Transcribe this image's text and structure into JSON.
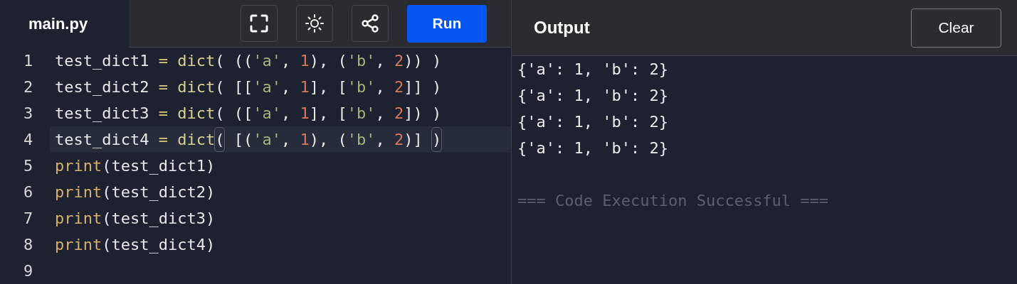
{
  "editor_tab": {
    "label": "main.py",
    "selected": true
  },
  "toolbar": {
    "run_label": "Run"
  },
  "output": {
    "title": "Output",
    "clear_label": "Clear",
    "lines": [
      {
        "kind": "result",
        "text": "{'a': 1, 'b': 2}"
      },
      {
        "kind": "result",
        "text": "{'a': 1, 'b': 2}"
      },
      {
        "kind": "result",
        "text": "{'a': 1, 'b': 2}"
      },
      {
        "kind": "result",
        "text": "{'a': 1, 'b': 2}"
      },
      {
        "kind": "status",
        "text": "=== Code Execution Successful ==="
      }
    ]
  },
  "code_lines": [
    {
      "number": "1",
      "active": false,
      "tokens": [
        {
          "kind": "plain",
          "text": "test_dict1"
        },
        {
          "kind": "op",
          "text": " = "
        },
        {
          "kind": "func",
          "text": "dict"
        },
        {
          "kind": "plain",
          "text": "( (("
        },
        {
          "kind": "str",
          "text": "'a'"
        },
        {
          "kind": "plain",
          "text": ", "
        },
        {
          "kind": "num",
          "text": "1"
        },
        {
          "kind": "plain",
          "text": "), ("
        },
        {
          "kind": "str",
          "text": "'b'"
        },
        {
          "kind": "plain",
          "text": ", "
        },
        {
          "kind": "num",
          "text": "2"
        },
        {
          "kind": "plain",
          "text": ")) )"
        }
      ]
    },
    {
      "number": "2",
      "active": false,
      "tokens": [
        {
          "kind": "plain",
          "text": "test_dict2"
        },
        {
          "kind": "op",
          "text": " = "
        },
        {
          "kind": "func",
          "text": "dict"
        },
        {
          "kind": "plain",
          "text": "( [["
        },
        {
          "kind": "str",
          "text": "'a'"
        },
        {
          "kind": "plain",
          "text": ", "
        },
        {
          "kind": "num",
          "text": "1"
        },
        {
          "kind": "plain",
          "text": "], ["
        },
        {
          "kind": "str",
          "text": "'b'"
        },
        {
          "kind": "plain",
          "text": ", "
        },
        {
          "kind": "num",
          "text": "2"
        },
        {
          "kind": "plain",
          "text": "]] )"
        }
      ]
    },
    {
      "number": "3",
      "active": false,
      "tokens": [
        {
          "kind": "plain",
          "text": "test_dict3"
        },
        {
          "kind": "op",
          "text": " = "
        },
        {
          "kind": "func",
          "text": "dict"
        },
        {
          "kind": "plain",
          "text": "( (["
        },
        {
          "kind": "str",
          "text": "'a'"
        },
        {
          "kind": "plain",
          "text": ", "
        },
        {
          "kind": "num",
          "text": "1"
        },
        {
          "kind": "plain",
          "text": "], ["
        },
        {
          "kind": "str",
          "text": "'b'"
        },
        {
          "kind": "plain",
          "text": ", "
        },
        {
          "kind": "num",
          "text": "2"
        },
        {
          "kind": "plain",
          "text": "]) )"
        }
      ]
    },
    {
      "number": "4",
      "active": true,
      "tokens": [
        {
          "kind": "plain",
          "text": "test_dict4"
        },
        {
          "kind": "op",
          "text": " = "
        },
        {
          "kind": "func",
          "text": "dict"
        },
        {
          "kind": "bracket_match",
          "text": "("
        },
        {
          "kind": "plain",
          "text": " [("
        },
        {
          "kind": "str",
          "text": "'a'"
        },
        {
          "kind": "plain",
          "text": ", "
        },
        {
          "kind": "num",
          "text": "1"
        },
        {
          "kind": "plain",
          "text": "), ("
        },
        {
          "kind": "str",
          "text": "'b'"
        },
        {
          "kind": "plain",
          "text": ", "
        },
        {
          "kind": "num",
          "text": "2"
        },
        {
          "kind": "plain",
          "text": ")] "
        },
        {
          "kind": "bracket_match",
          "text": ")"
        }
      ]
    },
    {
      "number": "5",
      "active": false,
      "tokens": [
        {
          "kind": "builtin",
          "text": "print"
        },
        {
          "kind": "plain",
          "text": "(test_dict1)"
        }
      ]
    },
    {
      "number": "6",
      "active": false,
      "tokens": [
        {
          "kind": "builtin",
          "text": "print"
        },
        {
          "kind": "plain",
          "text": "(test_dict2)"
        }
      ]
    },
    {
      "number": "7",
      "active": false,
      "tokens": [
        {
          "kind": "builtin",
          "text": "print"
        },
        {
          "kind": "plain",
          "text": "(test_dict3)"
        }
      ]
    },
    {
      "number": "8",
      "active": false,
      "tokens": [
        {
          "kind": "builtin",
          "text": "print"
        },
        {
          "kind": "plain",
          "text": "(test_dict4)"
        }
      ]
    },
    {
      "number": "9",
      "active": false
    }
  ]
}
